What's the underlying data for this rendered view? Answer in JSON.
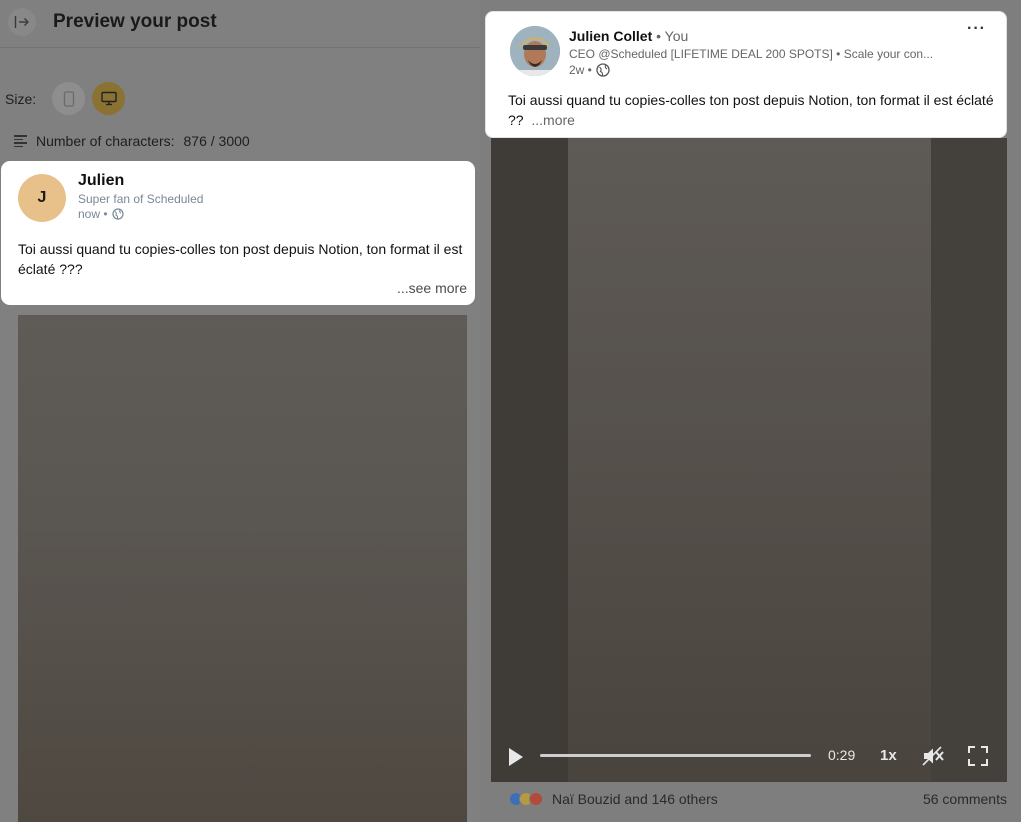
{
  "header": {
    "title": "Preview your post"
  },
  "size": {
    "label": "Size:",
    "options": [
      "mobile-icon",
      "desktop-icon"
    ],
    "selected": "desktop"
  },
  "chars": {
    "label": "Number of characters:",
    "value": "876 / 3000"
  },
  "preview_post": {
    "avatar_initial": "J",
    "author": "Julien",
    "subtitle": "Super fan of Scheduled",
    "time": "now •",
    "text": "Toi aussi quand tu copies-colles ton post depuis Notion, ton format il est éclaté ???",
    "see_more": "...see more"
  },
  "linkedin_post": {
    "author": "Julien Collet",
    "you_suffix": "• You",
    "headline": "CEO @Scheduled [LIFETIME DEAL 200 SPOTS] • Scale your con...",
    "time": "2w •",
    "menu": "···",
    "text": "Toi aussi quand tu copies-colles ton post depuis Notion, ton format il est éclaté ??",
    "more": "...more"
  },
  "video": {
    "time": "0:29",
    "speed": "1x"
  },
  "reactions": {
    "icons": [
      "like",
      "celebrate",
      "love"
    ],
    "summary": "Naï Bouzid and 146 others",
    "comments": "56 comments"
  },
  "colors": {
    "overlay_gray": "#808080",
    "card_white": "#ffffff",
    "avatar_bg": "#e8c08a",
    "desktop_selected": "#8a7232"
  }
}
